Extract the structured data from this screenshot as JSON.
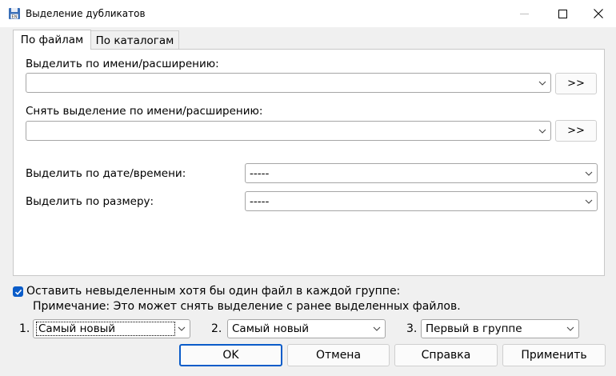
{
  "window": {
    "title": "Выделение дубликатов",
    "icons": {
      "app": "floppy-disk-icon",
      "minimize": "minimize-icon",
      "maximize": "maximize-icon",
      "close": "close-icon"
    }
  },
  "tabs": [
    {
      "label": "По файлам",
      "active": true
    },
    {
      "label": "По каталогам",
      "active": false
    }
  ],
  "files_tab": {
    "select_by_name_label": "Выделить по имени/расширению:",
    "select_by_name_value": "",
    "select_by_name_button": ">>",
    "deselect_by_name_label": "Снять выделение по имени/расширению:",
    "deselect_by_name_value": "",
    "deselect_by_name_button": ">>",
    "select_by_date_label": "Выделить по дате/времени:",
    "select_by_date_value": "-----",
    "select_by_size_label": "Выделить по размеру:",
    "select_by_size_value": "-----"
  },
  "keep_one": {
    "checked": true,
    "label": "Оставить невыделенным хотя бы один файл в каждой группе:",
    "note": "Примечание: Это может снять выделение с ранее выделенных файлов."
  },
  "criteria": [
    {
      "index": "1.",
      "value": "Самый новый"
    },
    {
      "index": "2.",
      "value": "Самый новый"
    },
    {
      "index": "3.",
      "value": "Первый в группе"
    }
  ],
  "buttons": {
    "ok": "OK",
    "cancel": "Отмена",
    "help": "Справка",
    "apply": "Применить"
  },
  "colors": {
    "accent": "#0a5cc9",
    "panel": "#ffffff",
    "dialog_bg": "#f0f0f0"
  }
}
